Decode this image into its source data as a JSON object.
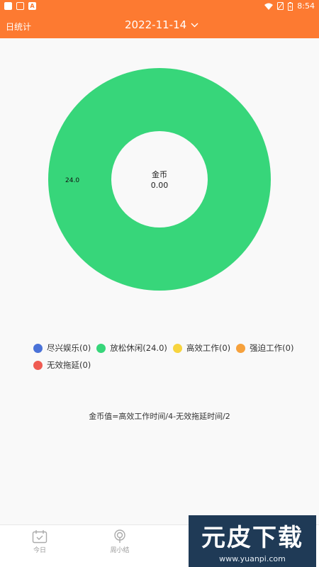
{
  "status_bar": {
    "time": "8:54"
  },
  "header": {
    "left_label": "日统计",
    "date": "2022-11-14",
    "date_dropdown_icon": "chevron-down-icon"
  },
  "chart_data": {
    "type": "pie",
    "donut": true,
    "center_label": "金币",
    "center_value": "0.00",
    "slices": [
      {
        "name": "尽兴娱乐",
        "value": 0,
        "color": "#4a72d8"
      },
      {
        "name": "放松休闲",
        "value": 24.0,
        "color": "#37d67a"
      },
      {
        "name": "高效工作",
        "value": 0,
        "color": "#f7d43e"
      },
      {
        "name": "强迫工作",
        "value": 0,
        "color": "#f6a13c"
      },
      {
        "name": "无效拖延",
        "value": 0,
        "color": "#ef5b52"
      }
    ],
    "data_label": "24.0"
  },
  "legend": [
    {
      "label": "尽兴娱乐(0)",
      "color": "#4a72d8"
    },
    {
      "label": "放松休闲(24.0)",
      "color": "#37d67a"
    },
    {
      "label": "高效工作(0)",
      "color": "#f7d43e"
    },
    {
      "label": "强迫工作(0)",
      "color": "#f6a13c"
    },
    {
      "label": "无效拖延(0)",
      "color": "#ef5b52"
    }
  ],
  "formula": "金币值=高效工作时间/4-无效拖延时间/2",
  "bottom_nav": [
    {
      "label": "今日",
      "icon": "calendar-icon"
    },
    {
      "label": "周小结",
      "icon": "broadcast-icon"
    }
  ],
  "watermark": {
    "title": "元皮下载",
    "url": "www.yuanpi.com"
  },
  "colors": {
    "primary": "#fd7a31"
  }
}
